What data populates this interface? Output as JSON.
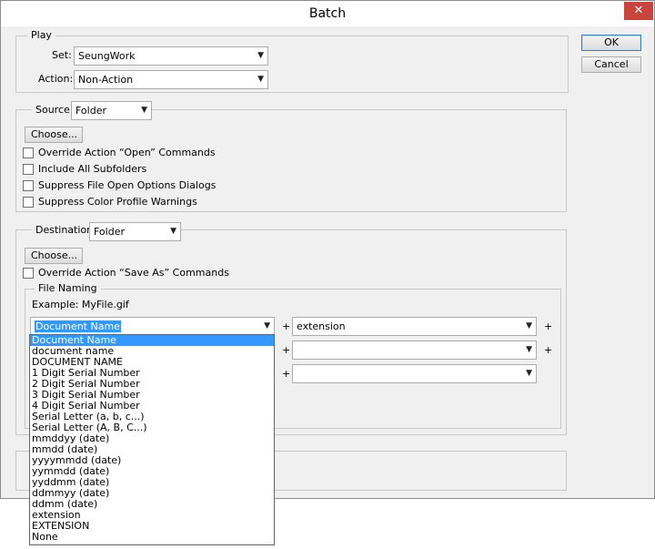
{
  "window": {
    "title": "Batch",
    "close_glyph": "✕"
  },
  "buttons": {
    "ok": "OK",
    "cancel": "Cancel"
  },
  "play": {
    "legend": "Play",
    "set_label": "Set:",
    "set_value": "SeungWork",
    "action_label": "Action:",
    "action_value": "Non-Action"
  },
  "source": {
    "label": "Source:",
    "value": "Folder",
    "choose": "Choose...",
    "options": [
      "Override Action “Open” Commands",
      "Include All Subfolders",
      "Suppress File Open Options Dialogs",
      "Suppress Color Profile Warnings"
    ]
  },
  "destination": {
    "label": "Destination:",
    "value": "Folder",
    "choose": "Choose...",
    "override": "Override Action “Save As” Commands"
  },
  "file_naming": {
    "legend": "File Naming",
    "example": "Example: MyFile.gif",
    "field1": "Document Name",
    "field2": "extension",
    "plus": "+"
  },
  "dropdown": {
    "items": [
      "Document Name",
      "document name",
      "DOCUMENT NAME",
      "1 Digit Serial Number",
      "2 Digit Serial Number",
      "3 Digit Serial Number",
      "4 Digit Serial Number",
      "Serial Letter (a, b, c...)",
      "Serial Letter (A, B, C...)",
      "mmddyy (date)",
      "mmdd (date)",
      "yyyymmdd (date)",
      "yymmdd (date)",
      "yyddmm (date)",
      "ddmmyy (date)",
      "ddmm (date)",
      "extension",
      "EXTENSION",
      "None"
    ]
  },
  "icons": {
    "dropdown_arrow": "▼"
  }
}
